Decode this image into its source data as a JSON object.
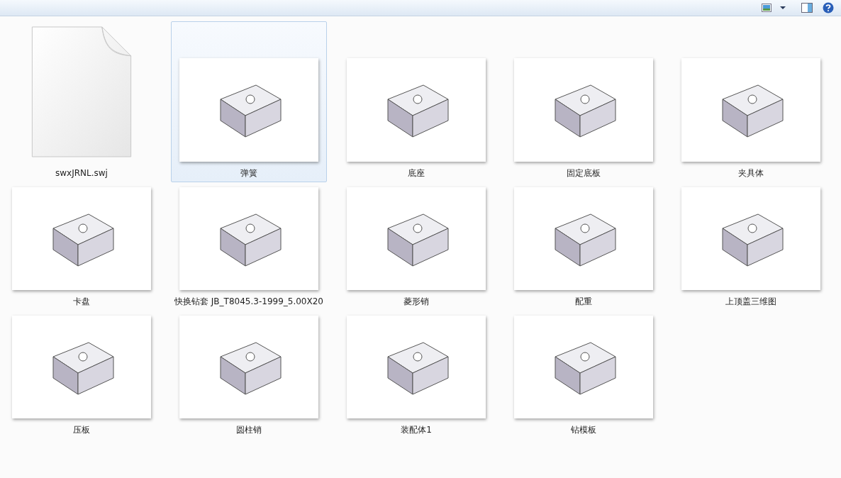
{
  "items": [
    {
      "label": "swxJRNL.swj",
      "kind": "file",
      "selected": false
    },
    {
      "label": "弹簧",
      "kind": "thumbnail",
      "selected": true
    },
    {
      "label": "底座",
      "kind": "thumbnail",
      "selected": false
    },
    {
      "label": "固定底板",
      "kind": "thumbnail",
      "selected": false
    },
    {
      "label": "夹具体",
      "kind": "thumbnail",
      "selected": false
    },
    {
      "label": "卡盘",
      "kind": "thumbnail",
      "selected": false
    },
    {
      "label": "快换钻套 JB_T8045.3-1999_5.00X20",
      "kind": "thumbnail",
      "selected": false
    },
    {
      "label": "菱形销",
      "kind": "thumbnail",
      "selected": false
    },
    {
      "label": "配重",
      "kind": "thumbnail",
      "selected": false
    },
    {
      "label": "上顶盖三维图",
      "kind": "thumbnail",
      "selected": false
    },
    {
      "label": "压板",
      "kind": "thumbnail",
      "selected": false
    },
    {
      "label": "圆柱销",
      "kind": "thumbnail",
      "selected": false
    },
    {
      "label": "装配体1",
      "kind": "thumbnail",
      "selected": false
    },
    {
      "label": "钻模板",
      "kind": "thumbnail",
      "selected": false
    }
  ]
}
